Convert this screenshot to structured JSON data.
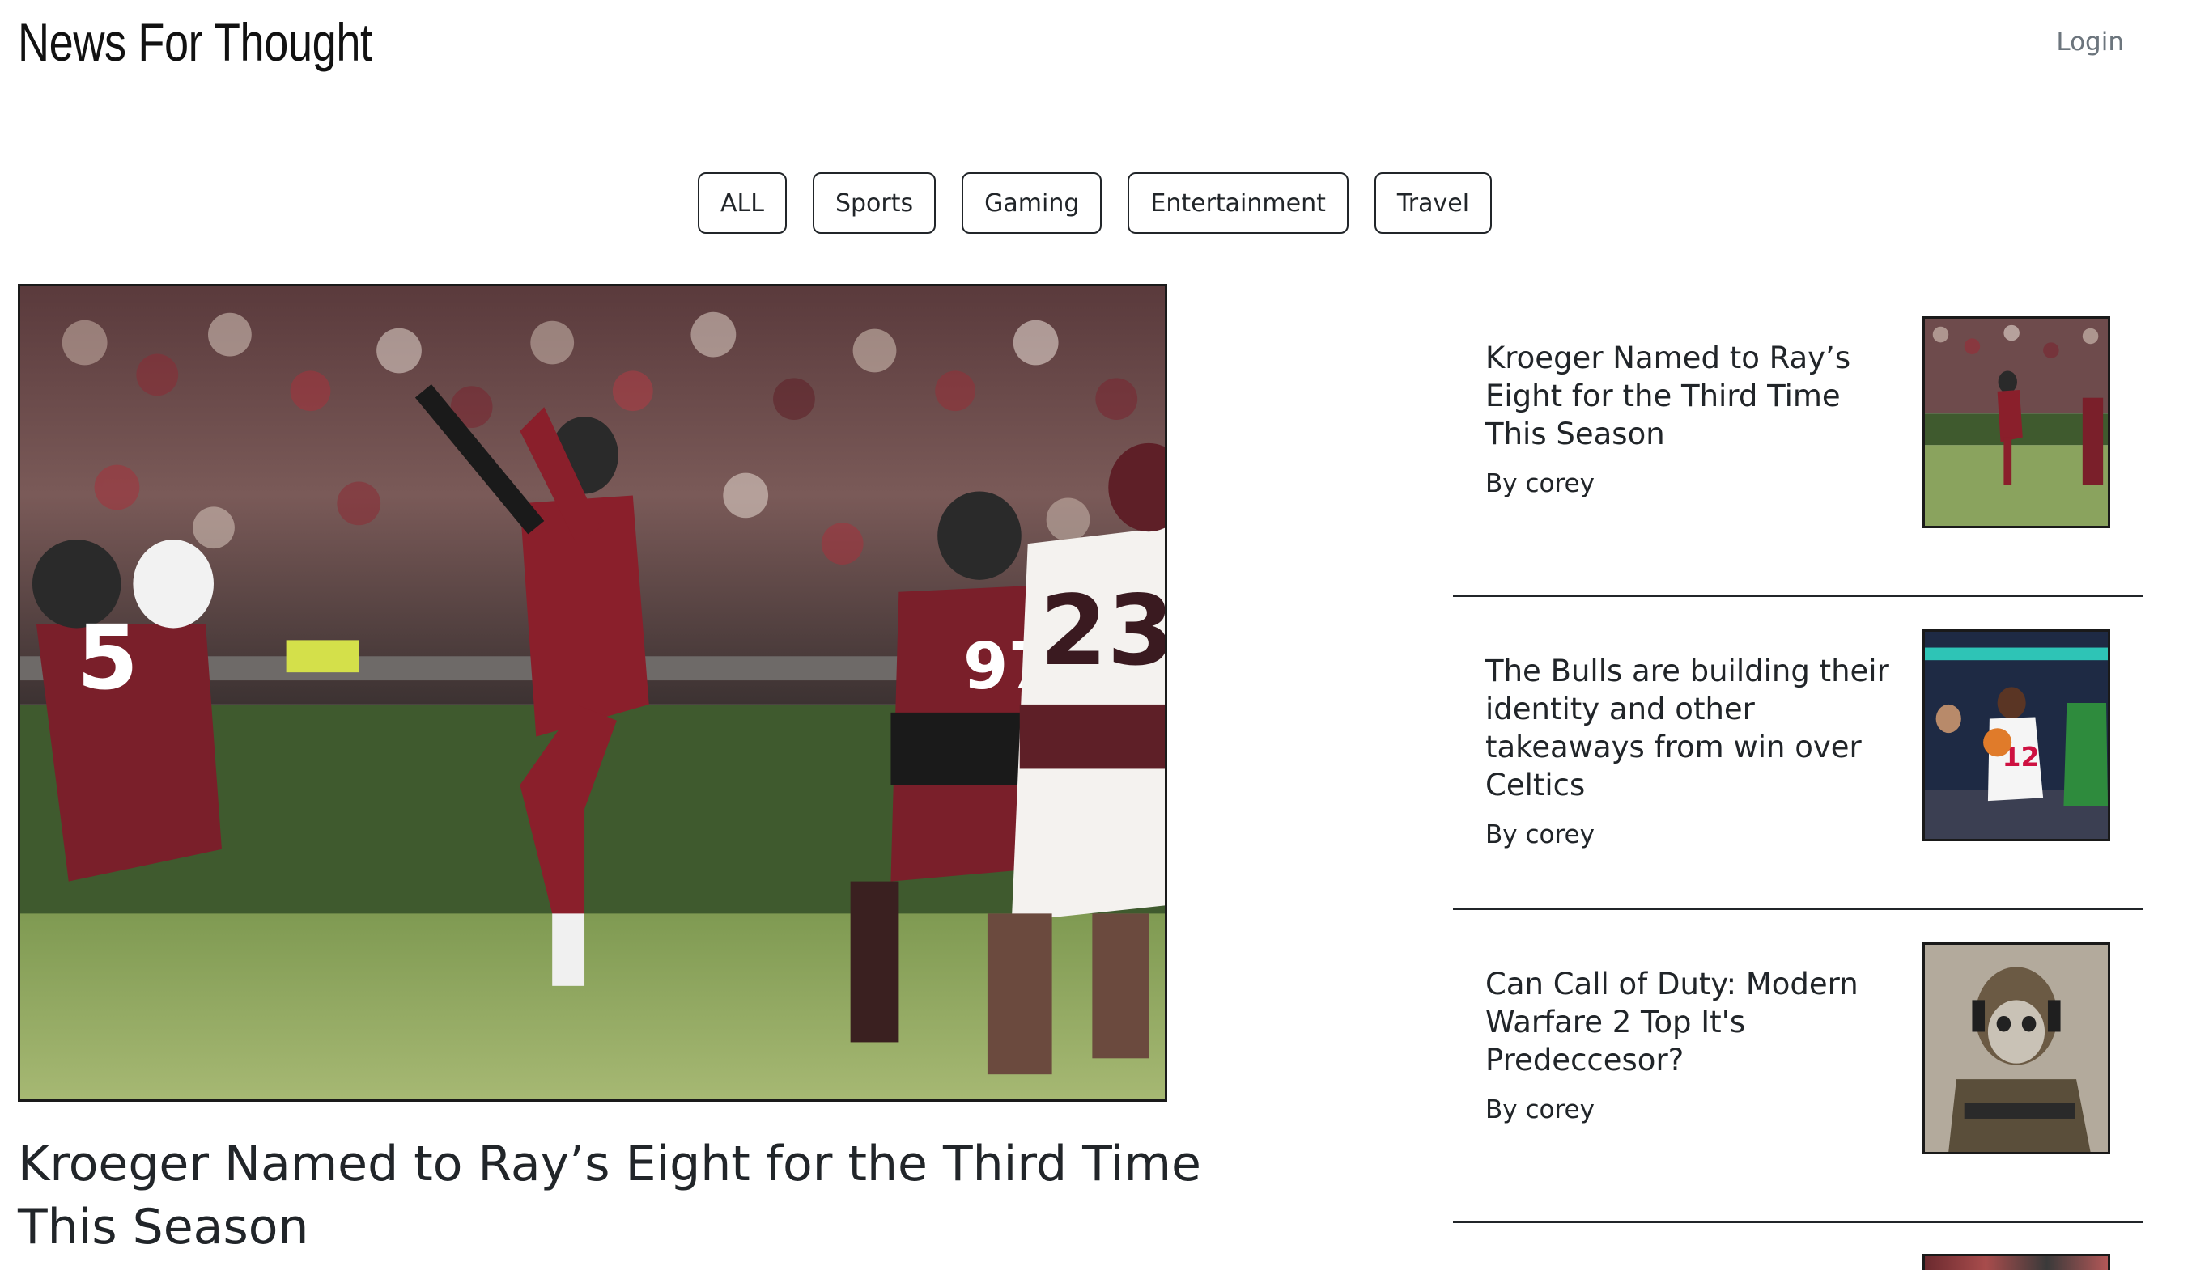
{
  "header": {
    "site_title": "News For Thought",
    "login_label": "Login"
  },
  "filters": [
    "ALL",
    "Sports",
    "Gaming",
    "Entertainment",
    "Travel"
  ],
  "featured": {
    "title": "Kroeger Named to Ray’s Eight for the Third Time This Season",
    "image_icon": "football-kicker-photo"
  },
  "articles": [
    {
      "title": "Kroeger Named to Ray’s Eight for the Third Time This Season",
      "author": "By corey",
      "thumbnail_icon": "football-kicker-thumbnail"
    },
    {
      "title": "The Bulls are building their identity and other takeaways from win over Celtics",
      "author": "By corey",
      "thumbnail_icon": "basketball-thumbnail"
    },
    {
      "title": "Can Call of Duty: Modern Warfare 2 Top It's Predeccesor?",
      "author": "By corey",
      "thumbnail_icon": "soldier-thumbnail"
    }
  ],
  "colors": {
    "text": "#212529",
    "muted": "#6c757d",
    "garnet": "#73000a"
  }
}
